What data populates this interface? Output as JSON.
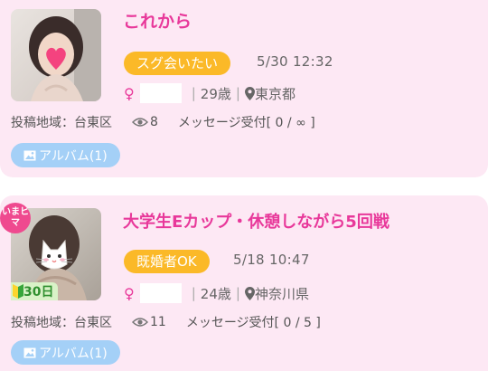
{
  "posts": [
    {
      "title": "これから",
      "tag": "スグ会いたい",
      "date": "5/30 12:32",
      "gender_symbol": "♀",
      "age": "29歳",
      "location": "東京都",
      "region": "投稿地域：台東区",
      "views": "8",
      "message_status": "メッセージ受付[ 0 / ∞ ]",
      "album": "アルバム(1)"
    },
    {
      "title": "大学生Eカップ・休憩しながら5回戦",
      "tag": "既婚者OK",
      "date": "5/18 10:47",
      "gender_symbol": "♀",
      "age": "24歳",
      "location": "神奈川県",
      "region": "投稿地域：台東区",
      "views": "11",
      "message_status": "メッセージ受付[ 0 / 5 ]",
      "album": "アルバム(1)",
      "ima_badge": "いまヒマ",
      "beginner_badge": "30日"
    }
  ],
  "colors": {
    "card_bg": "#fde8f4",
    "title": "#e8389a",
    "tag_bg": "#fbb928",
    "album_bg": "#a4d0f7",
    "ima_badge_bg": "#ef4a8f"
  },
  "icons": [
    "female-icon",
    "location-pin-icon",
    "eye-icon",
    "image-icon",
    "beginner-leaf-icon"
  ]
}
